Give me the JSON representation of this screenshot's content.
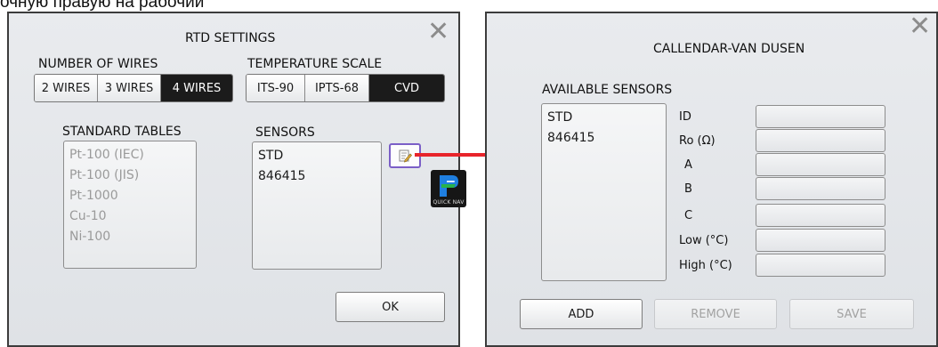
{
  "top_caption": "очную правую на рабочий",
  "rtd_settings": {
    "title": "RTD SETTINGS",
    "close_icon": "close-icon",
    "number_of_wires": {
      "label": "NUMBER OF WIRES",
      "options": [
        "2 WIRES",
        "3 WIRES",
        "4 WIRES"
      ],
      "selected": "4 WIRES"
    },
    "temperature_scale": {
      "label": "TEMPERATURE SCALE",
      "options": [
        "ITS-90",
        "IPTS-68",
        "CVD"
      ],
      "selected": "CVD"
    },
    "standard_tables": {
      "label": "STANDARD TABLES",
      "items": [
        "Pt-100 (IEC)",
        "Pt-100 (JIS)",
        "Pt-1000",
        "Cu-10",
        "Ni-100"
      ]
    },
    "sensors": {
      "label": "SENSORS",
      "items": [
        "STD",
        "846415"
      ]
    },
    "edit_icon": "edit-icon",
    "ok_label": "OK"
  },
  "quick_nav": {
    "label": "QUICK NAV",
    "icon": "quick-nav-icon"
  },
  "arrow_color": "#e8242b",
  "highlight_color": "#7b5fc7",
  "cvd_dialog": {
    "title": "CALLENDAR-VAN DUSEN",
    "close_icon": "close-icon",
    "available_sensors": {
      "label": "AVAILABLE SENSORS",
      "items": [
        "STD",
        "846415"
      ]
    },
    "fields": [
      {
        "label": "ID",
        "value": ""
      },
      {
        "label": "Ro (Ω)",
        "value": ""
      },
      {
        "label": "A",
        "value": ""
      },
      {
        "label": "B",
        "value": ""
      },
      {
        "label": "C",
        "value": ""
      },
      {
        "label": "Low (°C)",
        "value": ""
      },
      {
        "label": "High (°C)",
        "value": ""
      }
    ],
    "add_label": "ADD",
    "remove_label": "REMOVE",
    "save_label": "SAVE"
  }
}
